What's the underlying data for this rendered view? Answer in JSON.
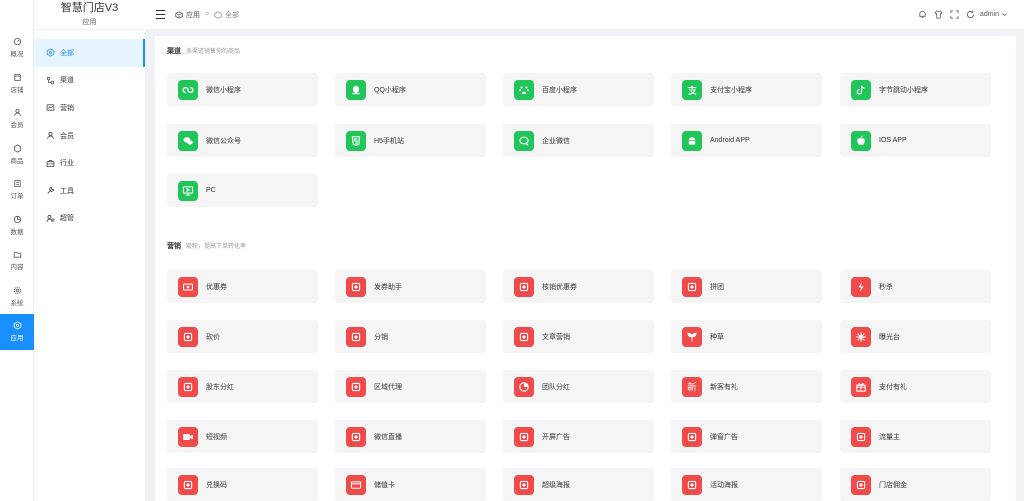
{
  "brand": {
    "title": "智慧门店V3",
    "subtitle": "应用"
  },
  "rail": [
    {
      "label": "概况",
      "icon": "dashboard-icon"
    },
    {
      "label": "店铺",
      "icon": "store-icon"
    },
    {
      "label": "会员",
      "icon": "user-icon"
    },
    {
      "label": "商品",
      "icon": "goods-icon"
    },
    {
      "label": "订单",
      "icon": "order-icon"
    },
    {
      "label": "数据",
      "icon": "chart-icon"
    },
    {
      "label": "内容",
      "icon": "folder-icon"
    },
    {
      "label": "系统",
      "icon": "settings-icon"
    },
    {
      "label": "应用",
      "icon": "apps-icon",
      "active": true
    }
  ],
  "breadcrumb": {
    "root": "应用",
    "separator": ">",
    "current": "全部"
  },
  "header": {
    "user": "admin"
  },
  "subnav": [
    {
      "label": "全部",
      "icon": "apps-icon",
      "active": true
    },
    {
      "label": "渠道",
      "icon": "channel-icon"
    },
    {
      "label": "营销",
      "icon": "marketing-icon"
    },
    {
      "label": "会员",
      "icon": "user-icon"
    },
    {
      "label": "行业",
      "icon": "briefcase-icon"
    },
    {
      "label": "工具",
      "icon": "tool-icon"
    },
    {
      "label": "超管",
      "icon": "admin-icon"
    }
  ],
  "sections": [
    {
      "title": "渠道",
      "desc": "多渠道销售你的商品",
      "color": "#21c65a",
      "items": [
        {
          "label": "微信小程序",
          "icon": "mini-program-icon"
        },
        {
          "label": "QQ小程序",
          "icon": "qq-icon"
        },
        {
          "label": "百度小程序",
          "icon": "baidu-icon"
        },
        {
          "label": "支付宝小程序",
          "icon": "alipay-icon"
        },
        {
          "label": "字节跳动小程序",
          "icon": "tiktok-icon"
        },
        {
          "label": "微信公众号",
          "icon": "wechat-icon"
        },
        {
          "label": "H5手机站",
          "icon": "h5-icon"
        },
        {
          "label": "企业微信",
          "icon": "wecom-icon"
        },
        {
          "label": "Android APP",
          "icon": "android-icon"
        },
        {
          "label": "IOS APP",
          "icon": "apple-icon"
        },
        {
          "label": "PC",
          "icon": "pc-icon"
        }
      ]
    },
    {
      "title": "营销",
      "desc": "吸粉，提高下单转化率",
      "color": "#f04b4b",
      "items": [
        {
          "label": "优惠券",
          "icon": "coupon-icon"
        },
        {
          "label": "发券助手",
          "icon": "coupon-send-icon"
        },
        {
          "label": "核销优惠券",
          "icon": "coupon-verify-icon"
        },
        {
          "label": "拼团",
          "icon": "group-buy-icon"
        },
        {
          "label": "秒杀",
          "icon": "flash-icon"
        },
        {
          "label": "砍价",
          "icon": "bargain-icon"
        },
        {
          "label": "分销",
          "icon": "distribution-icon"
        },
        {
          "label": "文章营销",
          "icon": "article-icon"
        },
        {
          "label": "种草",
          "icon": "sprout-icon"
        },
        {
          "label": "曝光台",
          "icon": "burst-icon"
        },
        {
          "label": "股东分红",
          "icon": "dividend-icon"
        },
        {
          "label": "区域代理",
          "icon": "region-icon"
        },
        {
          "label": "团队分红",
          "icon": "pie-icon"
        },
        {
          "label": "新客有礼",
          "icon": "new-customer-icon"
        },
        {
          "label": "支付有礼",
          "icon": "gift-icon"
        },
        {
          "label": "短视频",
          "icon": "video-icon"
        },
        {
          "label": "微信直播",
          "icon": "live-icon"
        },
        {
          "label": "开屏广告",
          "icon": "splash-ad-icon"
        },
        {
          "label": "弹窗广告",
          "icon": "popup-ad-icon"
        },
        {
          "label": "流量主",
          "icon": "traffic-icon"
        },
        {
          "label": "兑换码",
          "icon": "redeem-icon"
        },
        {
          "label": "储值卡",
          "icon": "card-icon"
        },
        {
          "label": "超级海报",
          "icon": "poster-icon"
        },
        {
          "label": "活动海报",
          "icon": "event-poster-icon"
        },
        {
          "label": "门店佣金",
          "icon": "commission-icon"
        }
      ]
    }
  ]
}
